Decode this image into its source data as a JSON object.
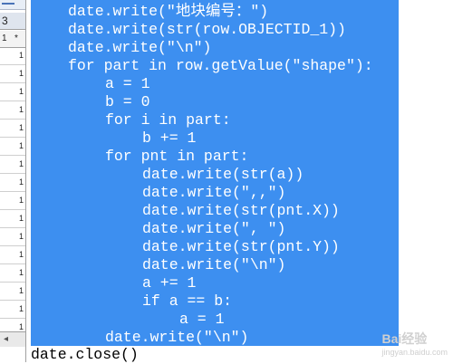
{
  "sheet": {
    "tab_row_label": "3",
    "selector": {
      "row": "1",
      "mark": "*"
    },
    "rows": [
      "1",
      "1",
      "1",
      "1",
      "1",
      "1",
      "1",
      "1",
      "1",
      "1",
      "1",
      "1",
      "1",
      "1",
      "1",
      "1"
    ],
    "scroll_arrow": "◂"
  },
  "code": {
    "lines": [
      "date.write(\"地块编号：\")",
      "date.write(str(row.OBJECTID_1))",
      "date.write(\"\\n\")",
      "for part in row.getValue(\"shape\"):",
      "a = 1",
      "b = 0",
      "for i in part:",
      "b += 1",
      "for pnt in part:",
      "date.write(str(a))",
      "date.write(\",,\")",
      "date.write(str(pnt.X))",
      "date.write(\", \")",
      "date.write(str(pnt.Y))",
      "date.write(\"\\n\")",
      "a += 1",
      "if a == b:",
      "a = 1",
      "date.write(\"\\n\")",
      "date.close()"
    ],
    "selection_color": "#3d8ff0"
  },
  "watermark": {
    "text": "Bai经验",
    "sub": "jingyan.baidu.com"
  }
}
